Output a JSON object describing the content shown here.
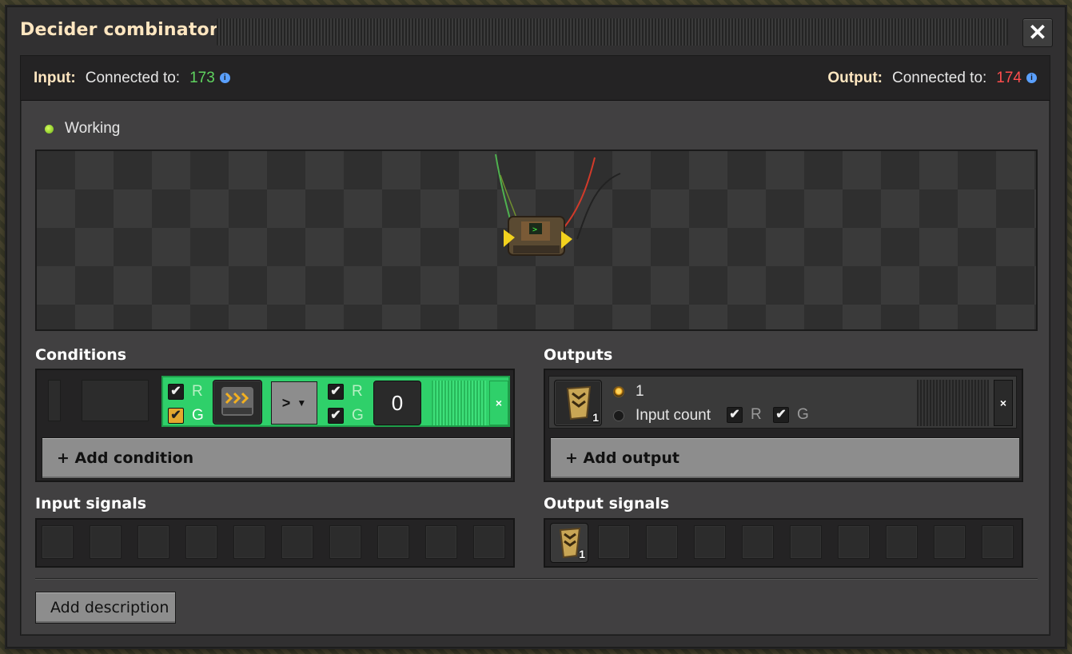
{
  "window": {
    "title": "Decider combinator",
    "close_icon": "close-icon"
  },
  "connections": {
    "input_label": "Input:",
    "input_text": "Connected to:",
    "input_network_id": "173",
    "output_label": "Output:",
    "output_text": "Connected to:",
    "output_network_id": "174",
    "input_color": "#5fd35f",
    "output_color": "#ff4d4d"
  },
  "status": {
    "text": "Working",
    "color": "#8fd21a"
  },
  "conditions": {
    "title": "Conditions",
    "row": {
      "left_r_label": "R",
      "left_g_label": "G",
      "left_r_checked": true,
      "left_g_checked": true,
      "signal_icon": "transport-belt-signal-icon",
      "comparator": ">",
      "right_r_label": "R",
      "right_g_label": "G",
      "right_r_checked": true,
      "right_g_checked": true,
      "constant": "0",
      "remove_label": "×"
    },
    "add_label": "+ Add condition"
  },
  "outputs": {
    "title": "Outputs",
    "row": {
      "signal_icon": "belt-signal-icon",
      "signal_count": "1",
      "option_constant": "1",
      "option_input_count": "Input count",
      "r_label": "R",
      "g_label": "G",
      "r_checked": true,
      "g_checked": true,
      "remove_label": "×"
    },
    "add_label": "+ Add output"
  },
  "input_signals": {
    "title": "Input signals"
  },
  "output_signals": {
    "title": "Output signals",
    "items": [
      {
        "icon": "belt-signal-icon",
        "count": "1"
      }
    ]
  },
  "footer": {
    "add_description_label": "Add description"
  }
}
